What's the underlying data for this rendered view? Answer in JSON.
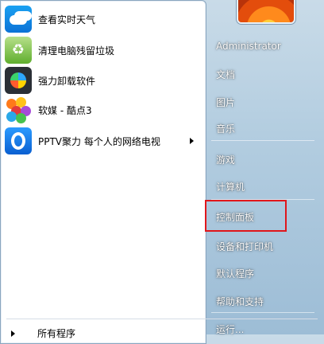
{
  "start_menu": {
    "left_items": [
      {
        "label": "查看实时天气",
        "icon": "weather-icon"
      },
      {
        "label": "清理电脑残留垃圾",
        "icon": "recycle-clean-icon"
      },
      {
        "label": "强力卸载软件",
        "icon": "uninstall-icon"
      },
      {
        "label": "软媒 - 酷点3",
        "icon": "kudian-icon"
      },
      {
        "label": "PPTV聚力 每个人的网络电视",
        "icon": "pptv-icon",
        "has_submenu": true
      }
    ],
    "all_programs_label": "所有程序",
    "user": {
      "name": "Administrator",
      "avatar_icon": "flower-avatar-icon"
    },
    "right_items": [
      {
        "label": "文档"
      },
      {
        "label": "图片"
      },
      {
        "label": "音乐"
      },
      {
        "label": "游戏"
      },
      {
        "label": "计算机"
      },
      {
        "label": "控制面板",
        "highlighted": true
      },
      {
        "label": "设备和打印机"
      },
      {
        "label": "默认程序"
      },
      {
        "label": "帮助和支持"
      },
      {
        "label": "运行..."
      }
    ],
    "highlight_color": "#e0161b"
  }
}
